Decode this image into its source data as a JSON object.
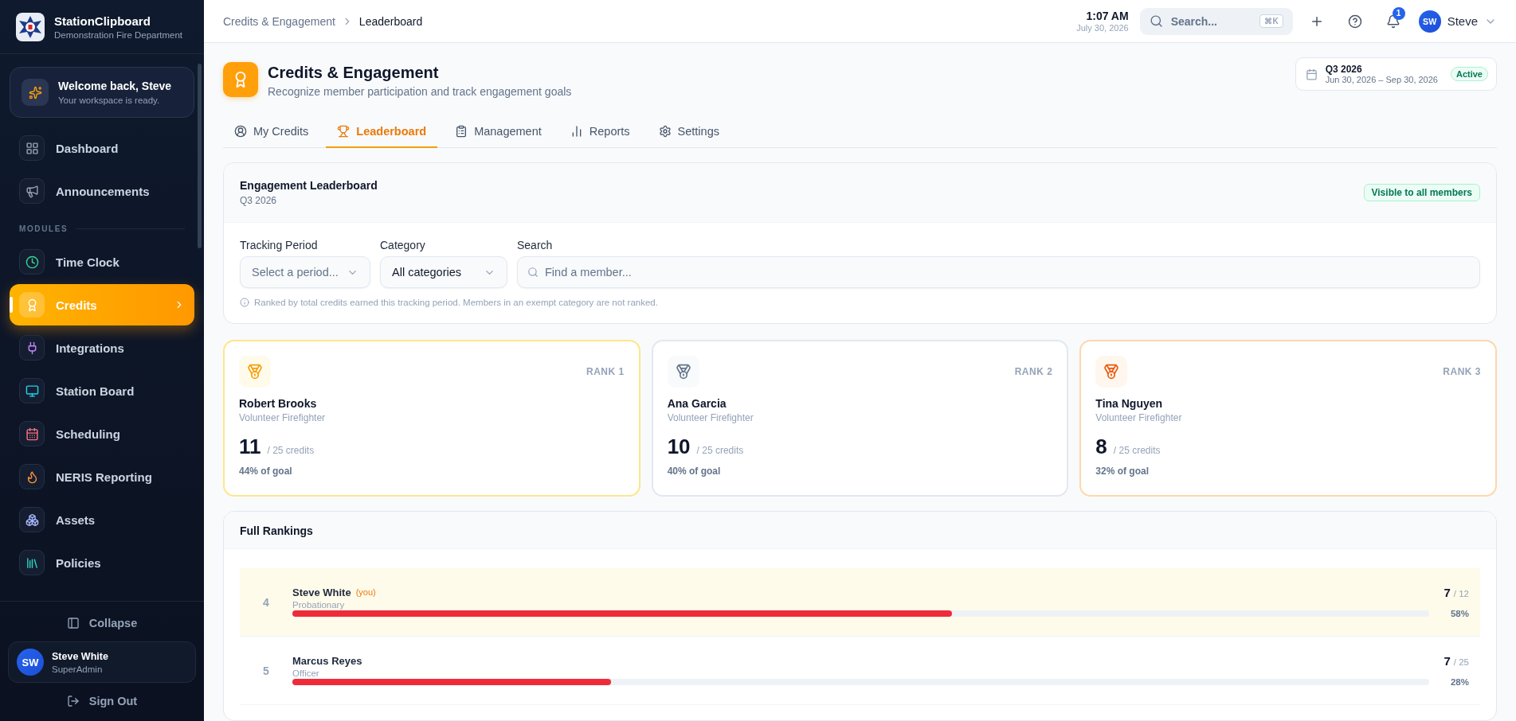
{
  "sidebar": {
    "brand": {
      "name": "StationClipboard",
      "subtitle": "Demonstration Fire Department"
    },
    "welcome": {
      "title": "Welcome back, Steve",
      "subtitle": "Your workspace is ready."
    },
    "items": [
      {
        "label": "Dashboard",
        "selected": false
      },
      {
        "label": "Announcements",
        "selected": false
      }
    ],
    "section_label": "MODULES",
    "modules": [
      {
        "label": "Time Clock",
        "selected": false
      },
      {
        "label": "Credits",
        "selected": true
      },
      {
        "label": "Integrations",
        "selected": false
      },
      {
        "label": "Station Board",
        "selected": false
      },
      {
        "label": "Scheduling",
        "selected": false
      },
      {
        "label": "NERIS Reporting",
        "selected": false
      },
      {
        "label": "Assets",
        "selected": false
      },
      {
        "label": "Policies",
        "selected": false
      }
    ],
    "collapse": "Collapse",
    "user": {
      "initials": "SW",
      "name": "Steve White",
      "role": "SuperAdmin"
    },
    "sign_out": "Sign Out"
  },
  "topbar": {
    "breadcrumb": [
      "Credits & Engagement",
      "Leaderboard"
    ],
    "time": "1:07 AM",
    "date": "July 30, 2026",
    "search": {
      "placeholder": "Search...",
      "shortcut": "⌘K"
    },
    "notifications": "1",
    "user": {
      "initials": "SW",
      "name": "Steve"
    }
  },
  "page": {
    "title": "Credits & Engagement",
    "subtitle": "Recognize member participation and track engagement goals",
    "period": {
      "name": "Q3 2026",
      "range": "Jun 30, 2026 – Sep 30, 2026",
      "status": "Active"
    }
  },
  "tabs": [
    {
      "label": "My Credits",
      "selected": false
    },
    {
      "label": "Leaderboard",
      "selected": true
    },
    {
      "label": "Management",
      "selected": false
    },
    {
      "label": "Reports",
      "selected": false
    },
    {
      "label": "Settings",
      "selected": false
    }
  ],
  "leaderboard": {
    "title": "Engagement Leaderboard",
    "subtitle": "Q3 2026",
    "visibility": "Visible to all members",
    "filters": [
      {
        "kind": "select",
        "label": "Tracking Period",
        "placeholder": "Select a period..."
      },
      {
        "kind": "select",
        "label": "Category",
        "value": "All categories"
      },
      {
        "kind": "search",
        "label": "Search",
        "placeholder": "Find a member..."
      }
    ],
    "note": "Ranked by total credits earned this tracking period. Members in an exempt category are not ranked."
  },
  "podium": [
    {
      "kind": "gold",
      "rank": "RANK 1",
      "name": "Robert Brooks",
      "role": "Volunteer Firefighter",
      "credits": "11",
      "goal": "/ 25 credits",
      "percent": "44% of goal"
    },
    {
      "kind": "silver",
      "rank": "RANK 2",
      "name": "Ana Garcia",
      "role": "Volunteer Firefighter",
      "credits": "10",
      "goal": "/ 25 credits",
      "percent": "40% of goal"
    },
    {
      "kind": "bronze",
      "rank": "RANK 3",
      "name": "Tina Nguyen",
      "role": "Volunteer Firefighter",
      "credits": "8",
      "goal": "/ 25 credits",
      "percent": "32% of goal"
    }
  ],
  "rankings": {
    "title": "Full Rankings",
    "rows": [
      {
        "rank": "4",
        "name": "Steve White",
        "tag": "(you)",
        "current": true,
        "role": "Probationary",
        "credits": "7",
        "goal": "/ 12",
        "level": 0.58,
        "percent": "58%"
      },
      {
        "rank": "5",
        "name": "Marcus Reyes",
        "current": false,
        "role": "Officer",
        "credits": "7",
        "goal": "/ 25",
        "level": 0.28,
        "percent": "28%"
      }
    ]
  }
}
